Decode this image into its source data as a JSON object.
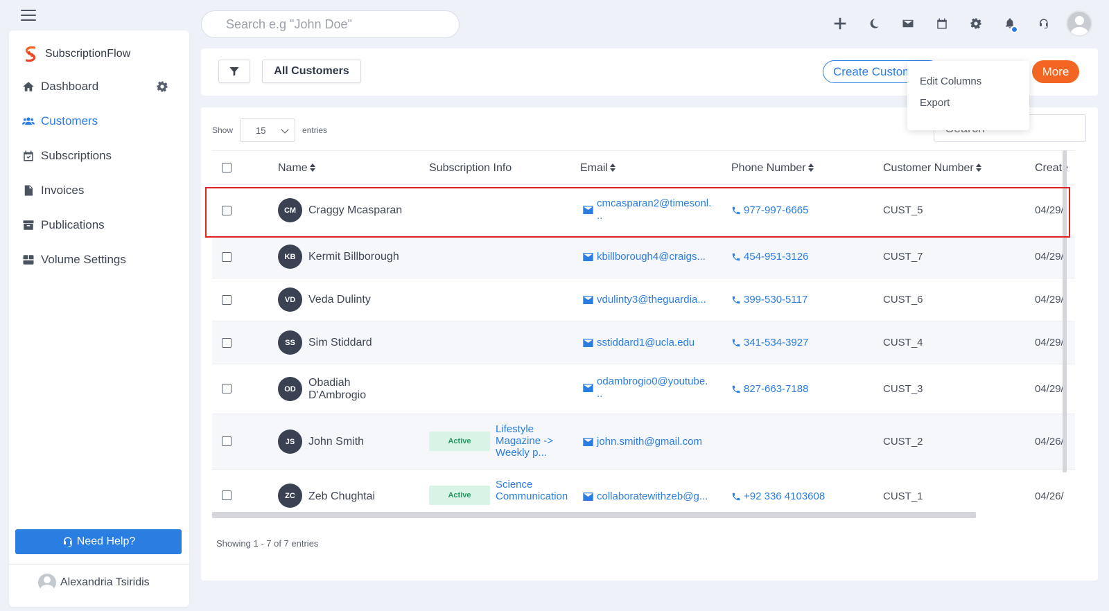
{
  "search": {
    "placeholder": "Search e.g \"John Doe\""
  },
  "top_icons": [
    "plus-icon",
    "moon-icon",
    "envelope-icon",
    "calendar-icon",
    "gear-icon",
    "bell-icon",
    "headset-icon"
  ],
  "brand": {
    "name": "SubscriptionFlow",
    "colors": {
      "primary": "#2a7de1",
      "accent": "#f26522"
    }
  },
  "sidebar": {
    "items": [
      {
        "label": "Dashboard",
        "icon": "home-icon"
      },
      {
        "label": "Customers",
        "icon": "users-icon",
        "active": true
      },
      {
        "label": "Subscriptions",
        "icon": "calendar-check-icon"
      },
      {
        "label": "Invoices",
        "icon": "invoice-icon"
      },
      {
        "label": "Publications",
        "icon": "archive-icon"
      },
      {
        "label": "Volume Settings",
        "icon": "boxes-icon"
      }
    ],
    "help_label": "Need Help?",
    "user_name": "Alexandria Tsiridis"
  },
  "toolbar": {
    "view_label": "All Customers",
    "create_label": "Create Customer",
    "more_label": "More",
    "dropdown": [
      "Edit Columns",
      "Export"
    ]
  },
  "table": {
    "show_label": "Show",
    "entries_value": "15",
    "entries_label": "entries",
    "search_placeholder": "Search",
    "columns": {
      "name": "Name",
      "subscription_info": "Subscription Info",
      "email": "Email",
      "phone": "Phone Number",
      "customer_number": "Customer Number",
      "created": "Create"
    },
    "rows": [
      {
        "initials": "CM",
        "name": "Craggy Mcasparan",
        "email": "cmcasparan2@timesonl.\n..",
        "phone": "977-997-6665",
        "customer_number": "CUST_5",
        "created": "04/29/"
      },
      {
        "initials": "KB",
        "name": "Kermit Billborough",
        "email": "kbillborough4@craigs...",
        "phone": "454-951-3126",
        "customer_number": "CUST_7",
        "created": "04/29/"
      },
      {
        "initials": "VD",
        "name": "Veda Dulinty",
        "email": "vdulinty3@theguardia...",
        "phone": "399-530-5117",
        "customer_number": "CUST_6",
        "created": "04/29/"
      },
      {
        "initials": "SS",
        "name": "Sim Stiddard",
        "email": "sstiddard1@ucla.edu",
        "phone": "341-534-3927",
        "customer_number": "CUST_4",
        "created": "04/29/"
      },
      {
        "initials": "OD",
        "name": "Obadiah\nD'Ambrogio",
        "email": "odambrogio0@youtube.\n..",
        "phone": "827-663-7188",
        "customer_number": "CUST_3",
        "created": "04/29/"
      },
      {
        "initials": "JS",
        "name": "John Smith",
        "status": "Active",
        "plan": "Lifestyle\nMagazine ->\nWeekly p...",
        "email": "john.smith@gmail.com",
        "phone": "",
        "customer_number": "CUST_2",
        "created": "04/26/"
      },
      {
        "initials": "ZC",
        "name": "Zeb Chughtai",
        "status": "Active",
        "plan": "Science\nCommunication",
        "email": "collaboratewithzeb@g...",
        "phone": "+92 336 4103608",
        "customer_number": "CUST_1",
        "created": "04/26/"
      }
    ],
    "footer": "Showing 1 - 7 of 7 entries"
  }
}
